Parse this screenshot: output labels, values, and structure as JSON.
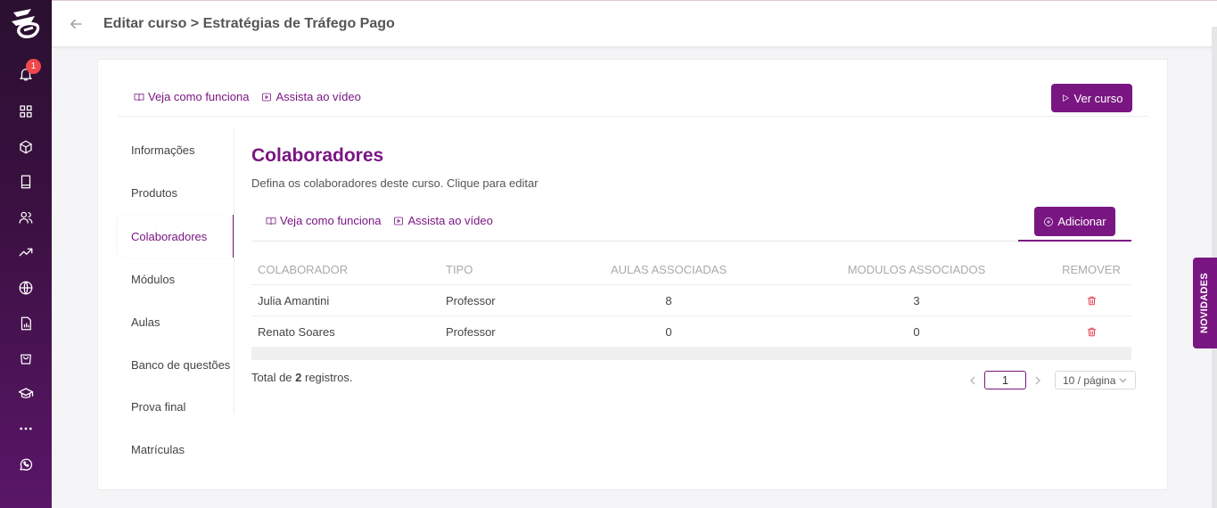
{
  "sidebar": {
    "notification_count": "1",
    "items": [
      "notifications-icon",
      "dashboard-icon",
      "products-icon",
      "courses-icon",
      "users-icon",
      "trending-icon",
      "globe-icon",
      "reports-icon",
      "shop-icon",
      "graduation-icon",
      "more-icon",
      "whatsapp-icon"
    ]
  },
  "header": {
    "breadcrumb": "Editar curso > Estratégias de Tráfego Pago"
  },
  "top_links": {
    "how_it_works": "Veja como funciona",
    "watch_video": "Assista ao vídeo",
    "view_course": "Ver curso"
  },
  "tabs": [
    {
      "label": "Informações"
    },
    {
      "label": "Produtos"
    },
    {
      "label": "Colaboradores"
    },
    {
      "label": "Módulos"
    },
    {
      "label": "Aulas"
    },
    {
      "label": "Banco de questões"
    },
    {
      "label": "Prova final"
    },
    {
      "label": "Matrículas"
    }
  ],
  "section": {
    "title": "Colaboradores",
    "description": "Defina os colaboradores deste curso. Clique para editar",
    "how_it_works": "Veja como funciona",
    "watch_video": "Assista ao vídeo",
    "add_label": "Adicionar"
  },
  "table": {
    "headers": [
      "COLABORADOR",
      "TIPO",
      "AULAS ASSOCIADAS",
      "MODULOS ASSOCIADOS",
      "REMOVER"
    ],
    "rows": [
      {
        "name": "Julia Amantini",
        "type": "Professor",
        "lessons": "8",
        "modules": "3"
      },
      {
        "name": "Renato Soares",
        "type": "Professor",
        "lessons": "0",
        "modules": "0"
      }
    ]
  },
  "footer": {
    "total_prefix": "Total de ",
    "total_count": "2",
    "total_suffix": " registros.",
    "page": "1",
    "page_size": "10 / página"
  },
  "novidades": "NOVIDADES",
  "colors": {
    "accent": "#7a1682",
    "danger": "#e0283a"
  }
}
